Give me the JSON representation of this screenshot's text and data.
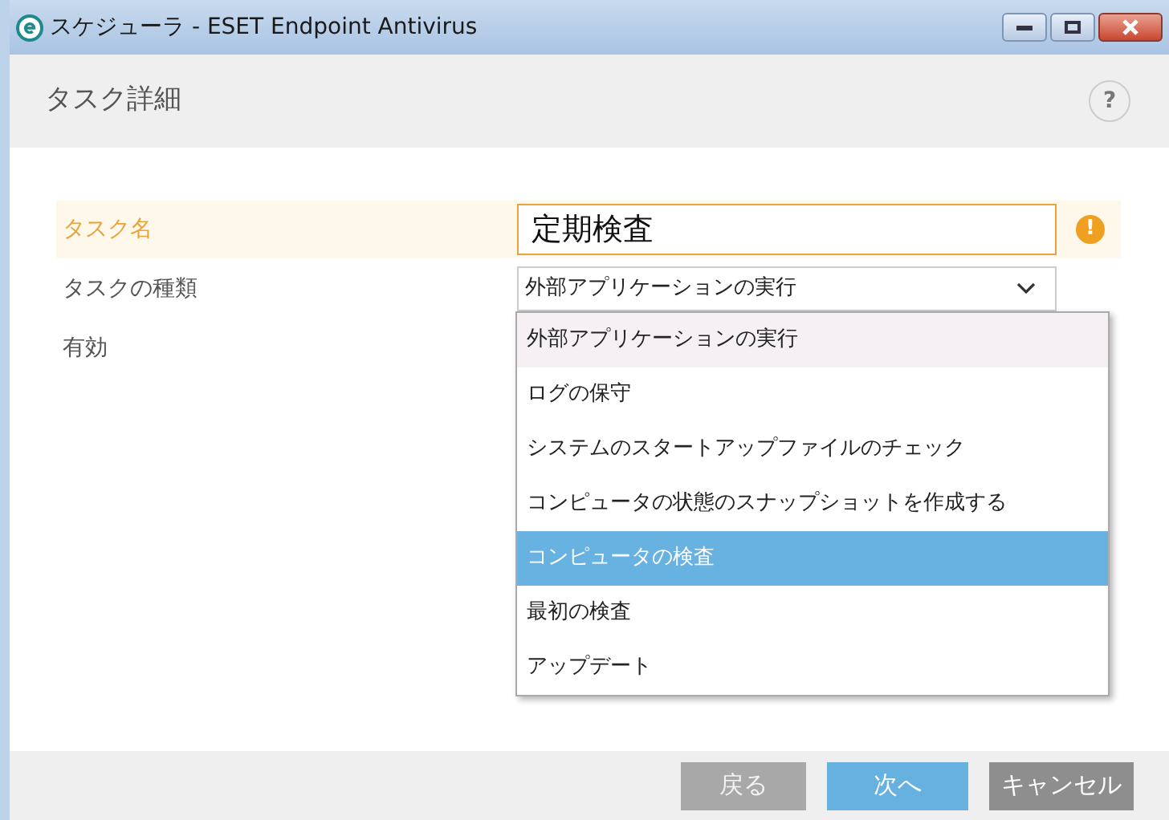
{
  "window": {
    "title": "スケジューラ - ESET Endpoint Antivirus"
  },
  "header": {
    "title": "タスク詳細",
    "help": "?"
  },
  "form": {
    "name_row": {
      "label": "タスク名",
      "value": "定期検査",
      "warning": true,
      "warning_icon": "!"
    },
    "type_row": {
      "label": "タスクの種類",
      "value": "外部アプリケーションの実行"
    },
    "enabled_row": {
      "label": "有効"
    }
  },
  "dropdown": {
    "items": [
      {
        "label": "外部アプリケーションの実行",
        "selected": false,
        "hovered": true
      },
      {
        "label": "ログの保守",
        "selected": false,
        "hovered": false
      },
      {
        "label": "システムのスタートアップファイルのチェック",
        "selected": false,
        "hovered": false
      },
      {
        "label": "コンピュータの状態のスナップショットを作成する",
        "selected": false,
        "hovered": false
      },
      {
        "label": "コンピュータの検査",
        "selected": true,
        "hovered": false
      },
      {
        "label": "最初の検査",
        "selected": false,
        "hovered": false
      },
      {
        "label": "アップデート",
        "selected": false,
        "hovered": false
      }
    ]
  },
  "buttons": [
    {
      "label": "戻る",
      "kind": "back",
      "disabled": true
    },
    {
      "label": "次へ",
      "kind": "next",
      "disabled": false
    },
    {
      "label": "キャンセル",
      "kind": "cancel",
      "disabled": false
    }
  ]
}
